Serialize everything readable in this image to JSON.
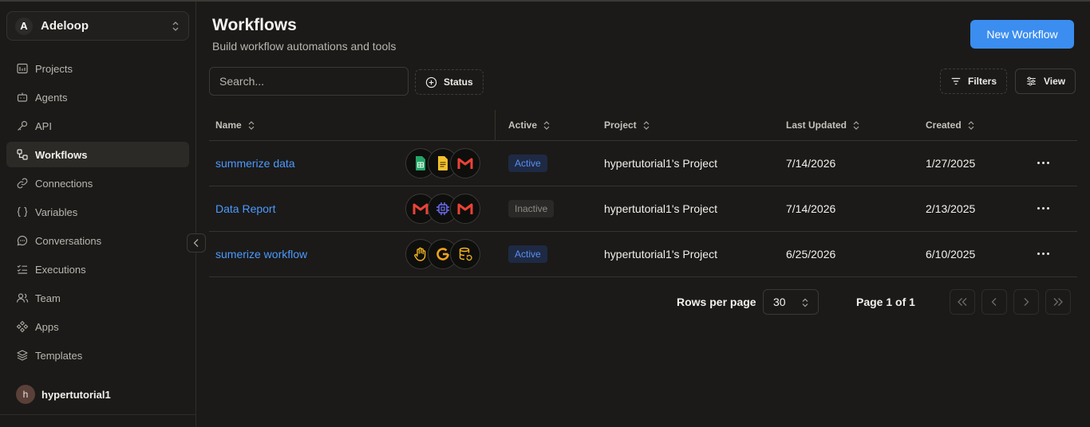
{
  "org": {
    "initial": "A",
    "name": "Adeloop"
  },
  "nav": [
    {
      "label": "Projects",
      "icon": "projects-icon"
    },
    {
      "label": "Agents",
      "icon": "bot-icon"
    },
    {
      "label": "API",
      "icon": "key-icon"
    },
    {
      "label": "Workflows",
      "icon": "workflow-icon",
      "active": true
    },
    {
      "label": "Connections",
      "icon": "link-icon"
    },
    {
      "label": "Variables",
      "icon": "braces-icon"
    },
    {
      "label": "Conversations",
      "icon": "chat-icon"
    },
    {
      "label": "Executions",
      "icon": "list-check-icon"
    },
    {
      "label": "Team",
      "icon": "users-icon"
    },
    {
      "label": "Apps",
      "icon": "apps-icon"
    },
    {
      "label": "Templates",
      "icon": "layers-icon"
    }
  ],
  "user": {
    "initial": "h",
    "name": "hypertutorial1"
  },
  "header": {
    "title": "Workflows",
    "subtitle": "Build workflow automations and tools",
    "new_button": "New Workflow"
  },
  "toolbar": {
    "search_placeholder": "Search...",
    "status": "Status",
    "filters": "Filters",
    "view": "View"
  },
  "table": {
    "columns": [
      "Name",
      "Active",
      "Project",
      "Last Updated",
      "Created"
    ],
    "rows": [
      {
        "name": "summerize data",
        "icons": [
          "google-sheets-icon",
          "google-docs-icon",
          "gmail-icon"
        ],
        "status": "Active",
        "project": "hypertutorial1's Project",
        "updated": "7/14/2026",
        "created": "1/27/2025"
      },
      {
        "name": "Data Report",
        "icons": [
          "gmail-icon",
          "chip-icon",
          "gmail-icon"
        ],
        "status": "Inactive",
        "project": "hypertutorial1's Project",
        "updated": "7/14/2026",
        "created": "2/13/2025"
      },
      {
        "name": "sumerize workflow",
        "icons": [
          "hand-icon",
          "google-icon",
          "database-icon"
        ],
        "status": "Active",
        "project": "hypertutorial1's Project",
        "updated": "6/25/2026",
        "created": "6/10/2025"
      }
    ]
  },
  "pagination": {
    "rows_per_page_label": "Rows per page",
    "rows_per_page": "30",
    "page_label": "Page 1 of 1"
  },
  "colors": {
    "accent": "#3b8df0",
    "link": "#4c9aff",
    "background": "#1b1a18"
  }
}
